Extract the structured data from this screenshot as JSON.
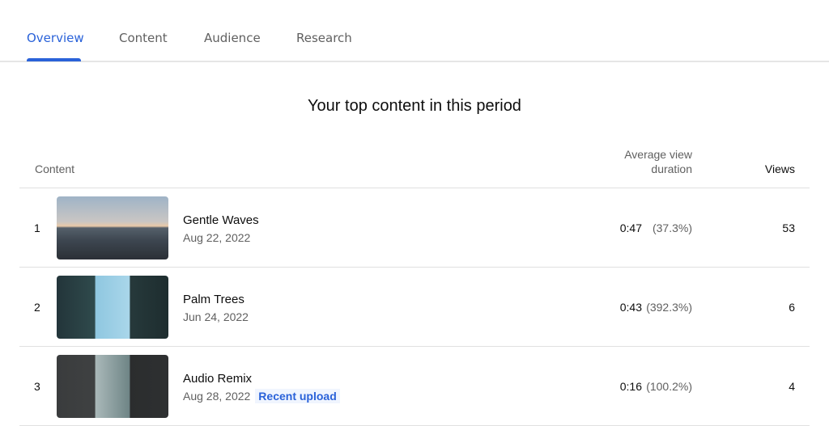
{
  "tabs": [
    {
      "label": "Overview",
      "active": true
    },
    {
      "label": "Content"
    },
    {
      "label": "Audience"
    },
    {
      "label": "Research"
    }
  ],
  "accent": "#2a62d9",
  "title": "Your top content in this period",
  "table": {
    "headers": {
      "content": "Content",
      "avg_duration": "Average view duration",
      "views": "Views"
    },
    "rows": [
      {
        "rank": "1",
        "title": "Gentle Waves",
        "date": "Aug 22, 2022",
        "duration": "0:47",
        "percent": "(37.3%)",
        "views": "53"
      },
      {
        "rank": "2",
        "title": "Palm Trees",
        "date": "Jun 24, 2022",
        "duration": "0:43",
        "percent": "(392.3%)",
        "views": "6"
      },
      {
        "rank": "3",
        "title": "Audio Remix",
        "date": "Aug 28, 2022",
        "badge": "Recent upload",
        "duration": "0:16",
        "percent": "(100.2%)",
        "views": "4"
      }
    ]
  }
}
